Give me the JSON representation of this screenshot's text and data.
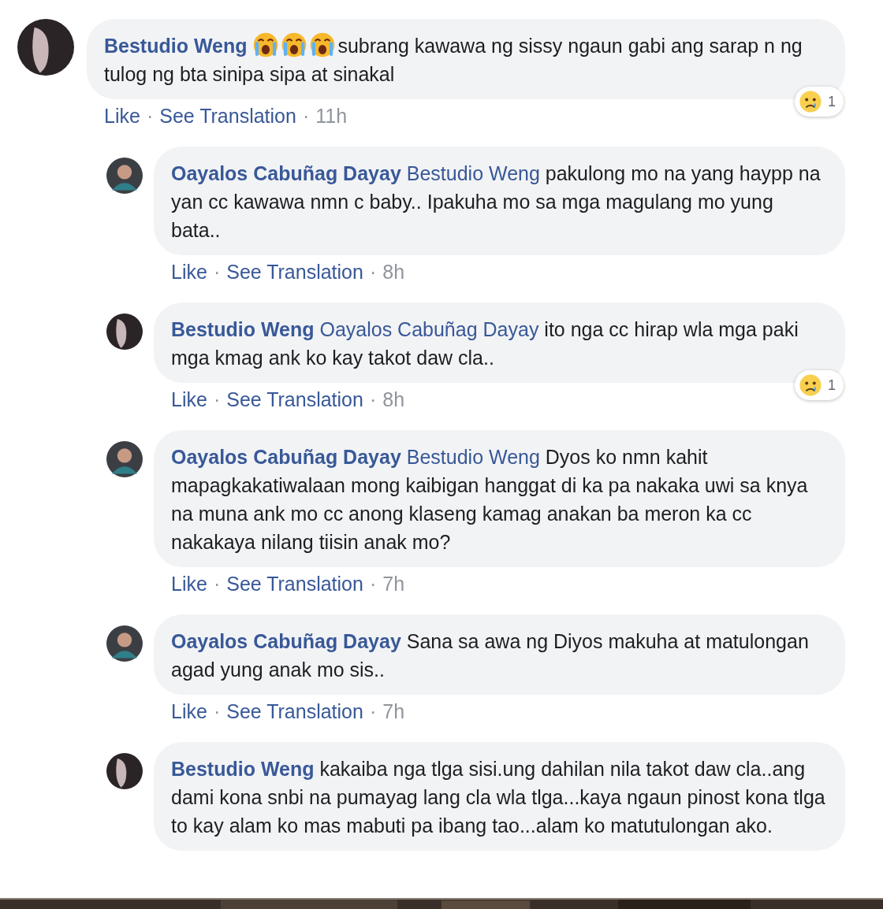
{
  "separator": "·",
  "comments": [
    {
      "author": "Bestudio Weng",
      "body": [
        {
          "kind": "emoji"
        },
        {
          "kind": "emoji"
        },
        {
          "kind": "emoji"
        },
        {
          "kind": "text",
          "text": "subrang kawawa ng sissy ngaun gabi ang sarap n ng tulog ng bta sinipa sipa at sinakal"
        }
      ],
      "actions": [
        "Like",
        "See Translation"
      ],
      "time": "11h",
      "reaction_count": "1",
      "children": [
        {
          "author": "Oayalos Cabuñag Dayay",
          "mention": "Bestudio Weng",
          "body": [
            {
              "kind": "text",
              "text": "pakulong mo na yang haypp na yan cc kawawa nmn c baby.. Ipakuha mo sa mga magulang mo yung bata.."
            }
          ],
          "actions": [
            "Like",
            "See Translation"
          ],
          "time": "8h"
        },
        {
          "author": "Bestudio Weng",
          "mention": "Oayalos Cabuñag Dayay",
          "body": [
            {
              "kind": "text",
              "text": "ito nga cc hirap wla mga paki mga kmag ank ko kay takot daw cla.."
            }
          ],
          "actions": [
            "Like",
            "See Translation"
          ],
          "time": "8h",
          "reaction_count": "1"
        },
        {
          "author": "Oayalos Cabuñag Dayay",
          "mention": "Bestudio Weng",
          "body": [
            {
              "kind": "text",
              "text": "Dyos ko nmn kahit mapagkakatiwalaan mong kaibigan hanggat di ka pa nakaka uwi sa knya na muna ank mo cc anong klaseng kamag anakan ba meron ka cc nakakaya nilang tiisin anak mo?"
            }
          ],
          "actions": [
            "Like",
            "See Translation"
          ],
          "time": "7h"
        },
        {
          "author": "Oayalos Cabuñag Dayay",
          "body": [
            {
              "kind": "text",
              "text": "Sana sa awa ng Diyos makuha at matulongan agad yung anak mo sis.."
            }
          ],
          "actions": [
            "Like",
            "See Translation"
          ],
          "time": "7h"
        },
        {
          "author": "Bestudio Weng",
          "body": [
            {
              "kind": "text",
              "text": "kakaiba nga tlga sisi.ung dahilan nila takot daw cla..ang dami kona snbi na pumayag lang cla wla tlga...kaya ngaun pinost kona tlga to kay alam ko mas mabuti pa ibang tao...alam ko matutulongan ako."
            }
          ]
        }
      ]
    }
  ]
}
